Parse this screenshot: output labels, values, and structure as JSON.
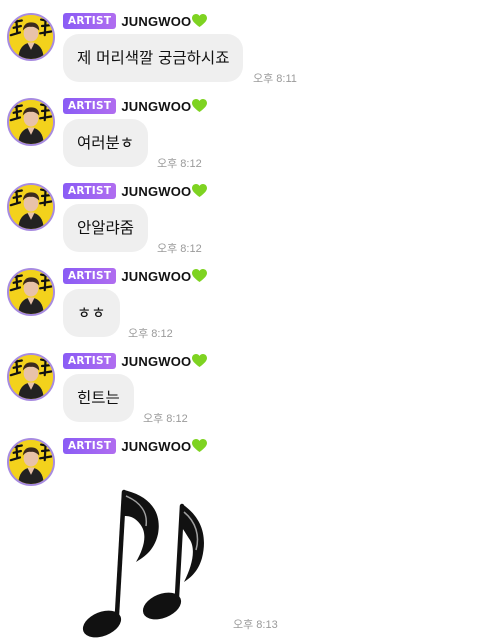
{
  "artist_badge": "ARTIST",
  "artist_name": "JUNGWOO",
  "heart_color": "#7ed321",
  "badge_color": "#8a5cf5",
  "avatar_icon": "artist-avatar",
  "messages": [
    {
      "text": "제 머리색깔 궁금하시죠",
      "time": "오후 8:11"
    },
    {
      "text": "여러분ㅎ",
      "time": "오후 8:12"
    },
    {
      "text": "안알랴줌",
      "time": "오후 8:12"
    },
    {
      "text": "ㅎㅎ",
      "time": "오후 8:12"
    },
    {
      "text": "힌트는",
      "time": "오후 8:12"
    }
  ],
  "sticker_message": {
    "sticker": "music-note-sticker",
    "time": "오후 8:13"
  }
}
